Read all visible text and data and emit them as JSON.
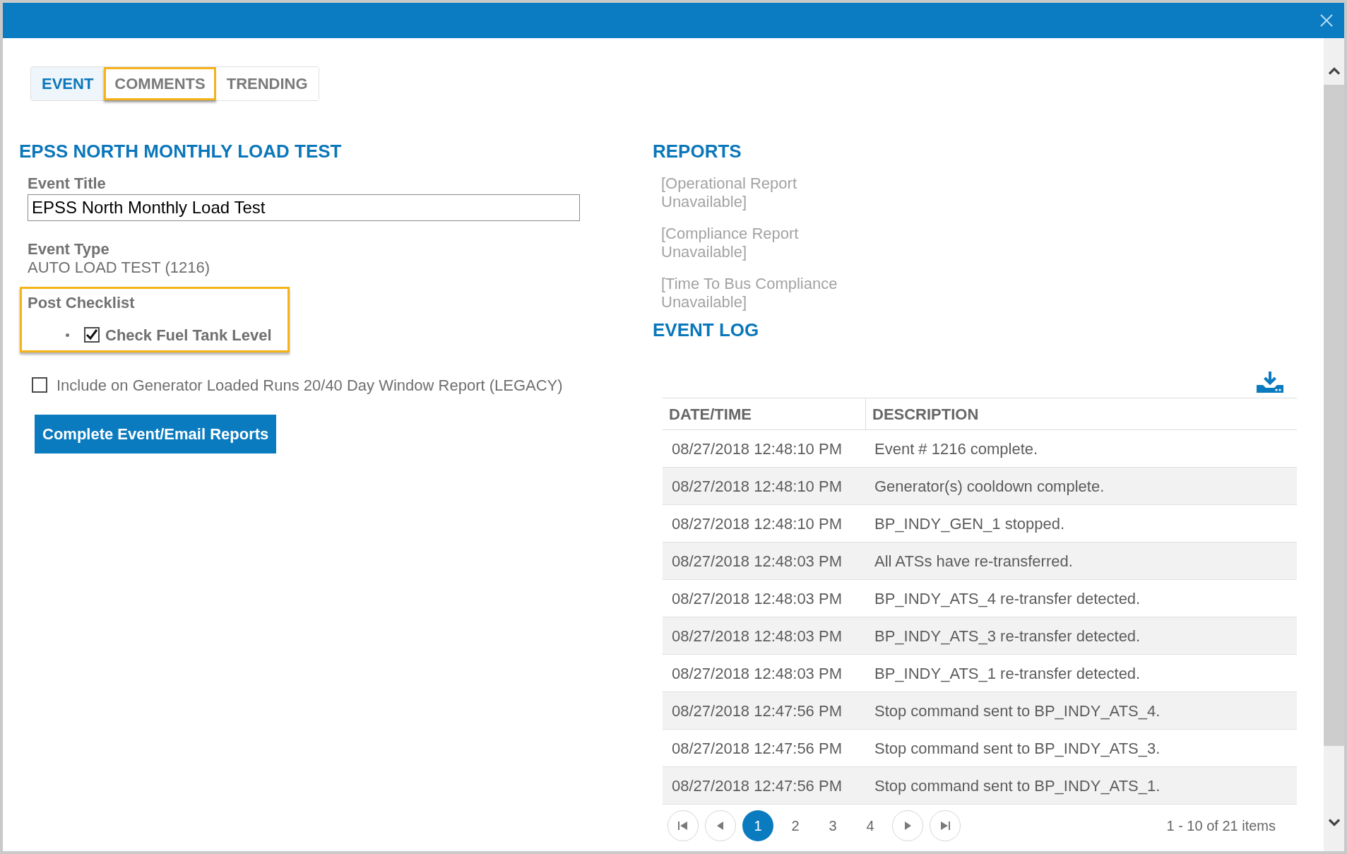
{
  "tabs": [
    {
      "label": "EVENT",
      "selected": true,
      "highlighted": false
    },
    {
      "label": "COMMENTS",
      "selected": false,
      "highlighted": true
    },
    {
      "label": "TRENDING",
      "selected": false,
      "highlighted": false
    }
  ],
  "event": {
    "heading": "EPSS NORTH MONTHLY LOAD TEST",
    "title_field": {
      "label": "Event Title",
      "value": "EPSS North Monthly Load Test"
    },
    "event_type": {
      "label": "Event Type",
      "value": "AUTO LOAD TEST (1216)"
    },
    "post_checklist": {
      "label": "Post Checklist",
      "highlighted": true,
      "items": [
        {
          "label": "Check Fuel Tank Level",
          "checked": true
        }
      ]
    },
    "include_option": {
      "label": "Include on Generator Loaded Runs 20/40 Day Window Report (LEGACY)",
      "checked": false
    },
    "complete_button": {
      "label": "Complete Event/Email Reports"
    }
  },
  "reports": {
    "heading": "REPORTS",
    "items": [
      "[Operational Report Unavailable]",
      "[Compliance Report Unavailable]",
      "[Time To Bus Compliance Unavailable]"
    ]
  },
  "event_log": {
    "heading": "EVENT LOG",
    "columns": [
      "DATE/TIME",
      "DESCRIPTION"
    ],
    "rows": [
      {
        "date_time": "08/27/2018 12:48:10 PM",
        "description": "Event # 1216 complete."
      },
      {
        "date_time": "08/27/2018 12:48:10 PM",
        "description": "Generator(s) cooldown complete."
      },
      {
        "date_time": "08/27/2018 12:48:10 PM",
        "description": "BP_INDY_GEN_1 stopped."
      },
      {
        "date_time": "08/27/2018 12:48:03 PM",
        "description": "All ATSs have re-transferred."
      },
      {
        "date_time": "08/27/2018 12:48:03 PM",
        "description": "BP_INDY_ATS_4 re-transfer detected."
      },
      {
        "date_time": "08/27/2018 12:48:03 PM",
        "description": "BP_INDY_ATS_3 re-transfer detected."
      },
      {
        "date_time": "08/27/2018 12:48:03 PM",
        "description": "BP_INDY_ATS_1 re-transfer detected."
      },
      {
        "date_time": "08/27/2018 12:47:56 PM",
        "description": "Stop command sent to BP_INDY_ATS_4."
      },
      {
        "date_time": "08/27/2018 12:47:56 PM",
        "description": "Stop command sent to BP_INDY_ATS_3."
      },
      {
        "date_time": "08/27/2018 12:47:56 PM",
        "description": "Stop command sent to BP_INDY_ATS_1."
      }
    ],
    "pagination": {
      "pages": [
        {
          "label": "1",
          "selected": true
        },
        {
          "label": "2",
          "selected": false
        },
        {
          "label": "3",
          "selected": false
        },
        {
          "label": "4",
          "selected": false
        }
      ],
      "summary": "1 - 10 of 21 items"
    }
  }
}
